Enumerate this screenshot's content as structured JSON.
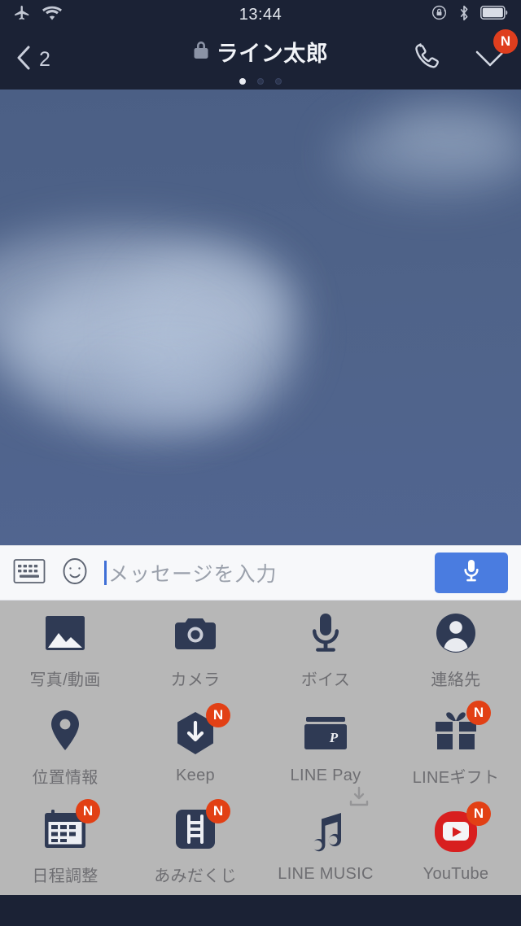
{
  "status_bar": {
    "time": "13:44",
    "left_icons": [
      "airplane-mode-icon",
      "wifi-icon"
    ],
    "right_icons": [
      "rotation-lock-icon",
      "bluetooth-icon",
      "battery-icon"
    ]
  },
  "nav_bar": {
    "back_label": "2",
    "back_icon": "chevron-left-icon",
    "lock_icon": "lock-icon",
    "title": "ライン太郎",
    "call_icon": "phone-icon",
    "menu_icon": "chevron-down-icon",
    "menu_badge": "N",
    "page_dots": {
      "count": 3,
      "active_index": 0
    }
  },
  "chat": {
    "background": "sky-photo-wallpaper",
    "sky_color": "#4f6389"
  },
  "input_bar": {
    "keyboard_icon": "keyboard-icon",
    "sticker_icon": "smiley-icon",
    "placeholder": "メッセージを入力",
    "value": "",
    "send_button_icon": "microphone-icon",
    "send_button_color": "#4a7ce0"
  },
  "attachment_panel": {
    "background": "#b7b7b7",
    "items": [
      {
        "label": "写真/動画",
        "icon": "photo-icon",
        "badge": null
      },
      {
        "label": "カメラ",
        "icon": "camera-icon",
        "badge": null
      },
      {
        "label": "ボイス",
        "icon": "microphone-icon",
        "badge": null
      },
      {
        "label": "連絡先",
        "icon": "contact-icon",
        "badge": null
      },
      {
        "label": "位置情報",
        "icon": "location-pin-icon",
        "badge": null
      },
      {
        "label": "Keep",
        "icon": "keep-icon",
        "badge": "N"
      },
      {
        "label": "LINE Pay",
        "icon": "wallet-icon",
        "badge": null
      },
      {
        "label": "LINEギフト",
        "icon": "gift-icon",
        "badge": "N"
      },
      {
        "label": "日程調整",
        "icon": "calendar-icon",
        "badge": "N"
      },
      {
        "label": "あみだくじ",
        "icon": "ladder-icon",
        "badge": "N"
      },
      {
        "label": "LINE MUSIC",
        "icon": "music-note-icon",
        "badge": null,
        "extra_icon": "download-icon"
      },
      {
        "label": "YouTube",
        "icon": "youtube-icon",
        "badge": "N"
      }
    ]
  },
  "colors": {
    "nav_background": "#1b2235",
    "badge_red": "#e24015",
    "accent_blue": "#4a7ce0",
    "icon_navy": "#2f3a54",
    "youtube_red": "#d81f1f"
  }
}
